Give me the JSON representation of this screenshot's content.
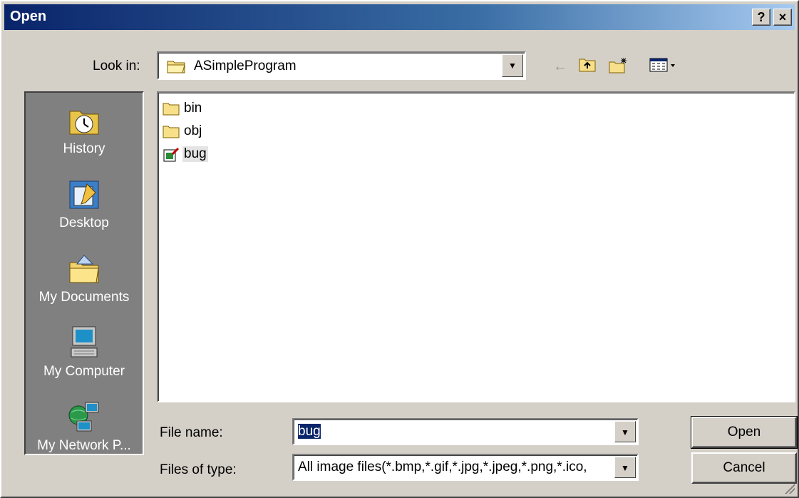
{
  "window": {
    "title": "Open",
    "help_label": "?",
    "close_label": "×"
  },
  "look_in": {
    "label": "Look in:",
    "value": "ASimpleProgram",
    "dropdown_glyph": "▼"
  },
  "toolbar": {
    "back_icon": "←",
    "up_icon": "up-folder",
    "new_folder_icon": "new-folder",
    "views_icon": "views-menu"
  },
  "places": [
    {
      "label": "History",
      "icon": "history-icon"
    },
    {
      "label": "Desktop",
      "icon": "desktop-icon"
    },
    {
      "label": "My Documents",
      "icon": "my-documents-icon"
    },
    {
      "label": "My Computer",
      "icon": "my-computer-icon"
    },
    {
      "label": "My Network P...",
      "icon": "network-icon"
    }
  ],
  "files": [
    {
      "name": "bin",
      "type": "folder"
    },
    {
      "name": "obj",
      "type": "folder"
    },
    {
      "name": "bug",
      "type": "file",
      "selected": true
    }
  ],
  "file_name": {
    "label": "File name:",
    "value": "bug"
  },
  "file_type": {
    "label": "Files of type:",
    "value": "All image files(*.bmp,*.gif,*.jpg,*.jpeg,*.png,*.ico,"
  },
  "buttons": {
    "open": "Open",
    "cancel": "Cancel"
  },
  "colors": {
    "title_start": "#0a246a",
    "title_end": "#a6caf0",
    "face": "#d4d0c8",
    "places_bg": "#808080"
  }
}
